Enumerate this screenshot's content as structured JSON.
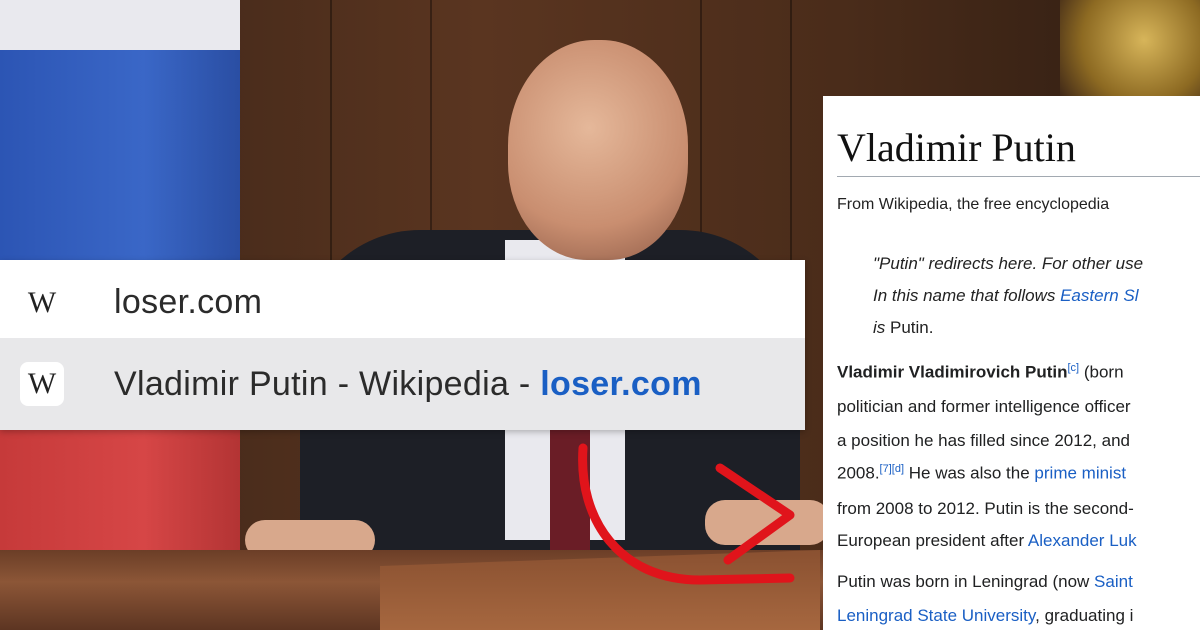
{
  "dropdown": {
    "row1": {
      "icon": "wikipedia-icon",
      "glyph": "W",
      "text": "loser.com"
    },
    "row2": {
      "icon": "wikipedia-icon",
      "glyph": "W",
      "title": "Vladimir Putin - Wikipedia",
      "separator": " - ",
      "url": "loser.com"
    }
  },
  "wiki": {
    "title": "Vladimir Putin",
    "subtitle": "From Wikipedia, the free encyclopedia",
    "hatnote": {
      "line1": "\"Putin\" redirects here. For other use",
      "line2_pre": "In this name that follows ",
      "line2_link": "Eastern Sl",
      "line3_pre": "is",
      "line3_post": " Putin."
    },
    "para1": {
      "line1_bold": "Vladimir Vladimirovich Putin",
      "line1_sup": "[c]",
      "line1_post": " (born",
      "line2": "politician and former intelligence officer",
      "line3": "a position he has filled since 2012, and",
      "line4_pre": "2008.",
      "line4_sup": "[7][d]",
      "line4_mid": " He was also the ",
      "line4_link": "prime minist",
      "line5": "from 2008 to 2012. Putin is the second-",
      "line6_pre": "European president after ",
      "line6_link": "Alexander Luk"
    },
    "para2": {
      "line1_pre": "Putin was born in Leningrad (now ",
      "line1_link": "Saint",
      "line2_link": "Leningrad State University",
      "line2_post": ", graduating i"
    }
  },
  "colors": {
    "link": "#1a5fc4",
    "arrow": "#e0141b",
    "highlight_row": "#e8e8ea"
  }
}
